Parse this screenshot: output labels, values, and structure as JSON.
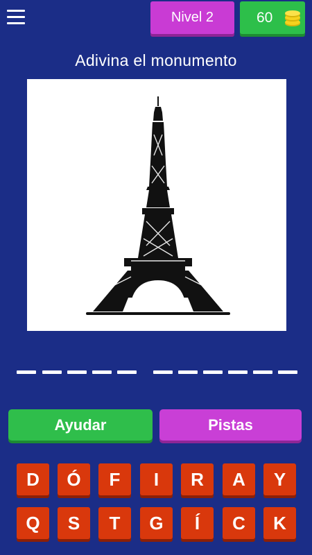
{
  "header": {
    "menu_icon": "hamburger-menu-icon",
    "level_label": "Nivel 2",
    "coins": "60",
    "coin_icon": "coin-stack-icon"
  },
  "title": "Adivina el monumento",
  "picture": {
    "subject": "eiffel-tower-silhouette"
  },
  "answer": {
    "word_lengths": [
      5,
      6
    ]
  },
  "actions": {
    "help_label": "Ayudar",
    "hints_label": "Pistas"
  },
  "keyboard": {
    "row1": [
      "D",
      "Ó",
      "F",
      "I",
      "R",
      "A",
      "Y"
    ],
    "row2": [
      "Q",
      "S",
      "T",
      "G",
      "Í",
      "C",
      "K"
    ]
  },
  "colors": {
    "background": "#1b2d87",
    "green": "#2fbe4b",
    "purple": "#c93fd6",
    "key": "#d9380c"
  }
}
